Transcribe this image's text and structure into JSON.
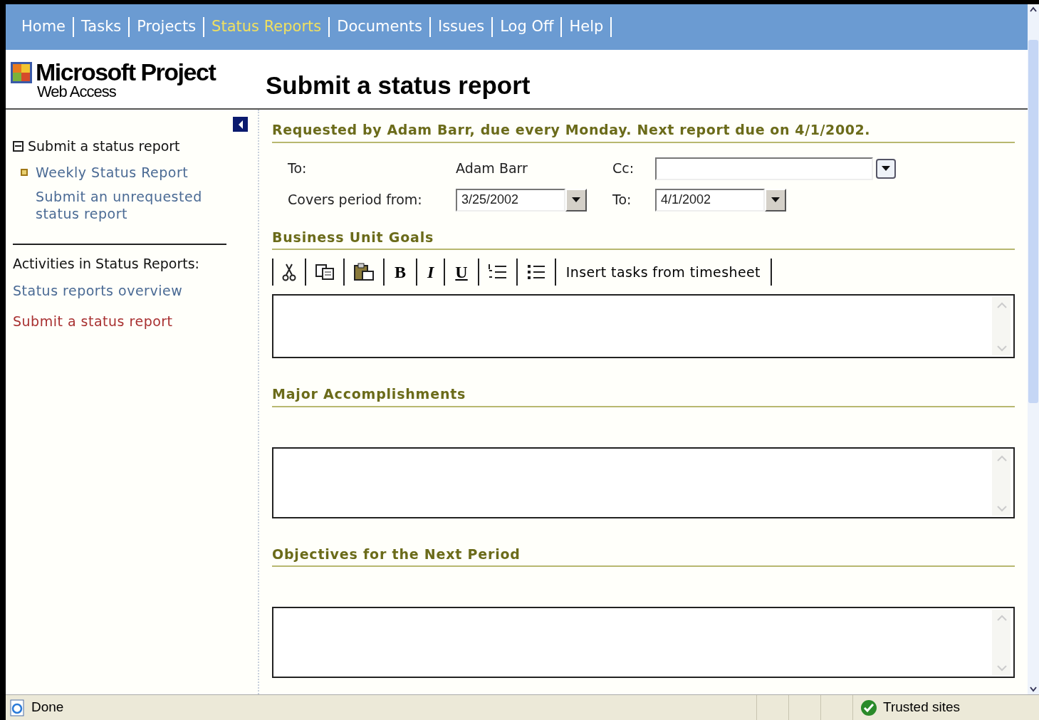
{
  "nav": [
    {
      "label": "Home",
      "selected": false
    },
    {
      "label": "Tasks",
      "selected": false
    },
    {
      "label": "Projects",
      "selected": false
    },
    {
      "label": "Status Reports",
      "selected": true
    },
    {
      "label": "Documents",
      "selected": false
    },
    {
      "label": "Issues",
      "selected": false
    },
    {
      "label": "Log Off",
      "selected": false
    },
    {
      "label": "Help",
      "selected": false
    }
  ],
  "logo": {
    "title": "Microsoft Project",
    "subtitle": "Web Access"
  },
  "page_title": "Submit a status report",
  "sidebar": {
    "tree": {
      "label": "Submit a status report",
      "expanded": true,
      "children": [
        {
          "label": "Weekly Status Report",
          "selected": true
        },
        {
          "label": "Submit an unrequested status report",
          "selected": false
        }
      ]
    },
    "activities_title": "Activities in Status Reports:",
    "activities": [
      {
        "label": "Status reports overview",
        "selected": false
      },
      {
        "label": "Submit a status report",
        "selected": true
      }
    ]
  },
  "request_line": "Requested by Adam Barr, due every Monday. Next report due on 4/1/2002.",
  "form": {
    "to_label": "To:",
    "to_value": "Adam Barr",
    "cc_label": "Cc:",
    "period_label": "Covers period from:",
    "period_from": "3/25/2002",
    "period_to_label": "To:",
    "period_to": "4/1/2002"
  },
  "sections": [
    {
      "heading": "Business Unit Goals",
      "toolbar": [
        {
          "kind": "cut"
        },
        {
          "kind": "copy"
        },
        {
          "kind": "paste"
        },
        {
          "kind": "bold",
          "label": "B"
        },
        {
          "kind": "italic",
          "label": "I"
        },
        {
          "kind": "underline",
          "label": "U"
        },
        {
          "kind": "numbered"
        },
        {
          "kind": "bulleted"
        },
        {
          "kind": "text",
          "label": "Insert tasks from timesheet"
        }
      ]
    },
    {
      "heading": "Major Accomplishments"
    },
    {
      "heading": "Objectives for the Next Period"
    }
  ],
  "status_bar": {
    "text": "Done",
    "zone": "Trusted sites"
  }
}
